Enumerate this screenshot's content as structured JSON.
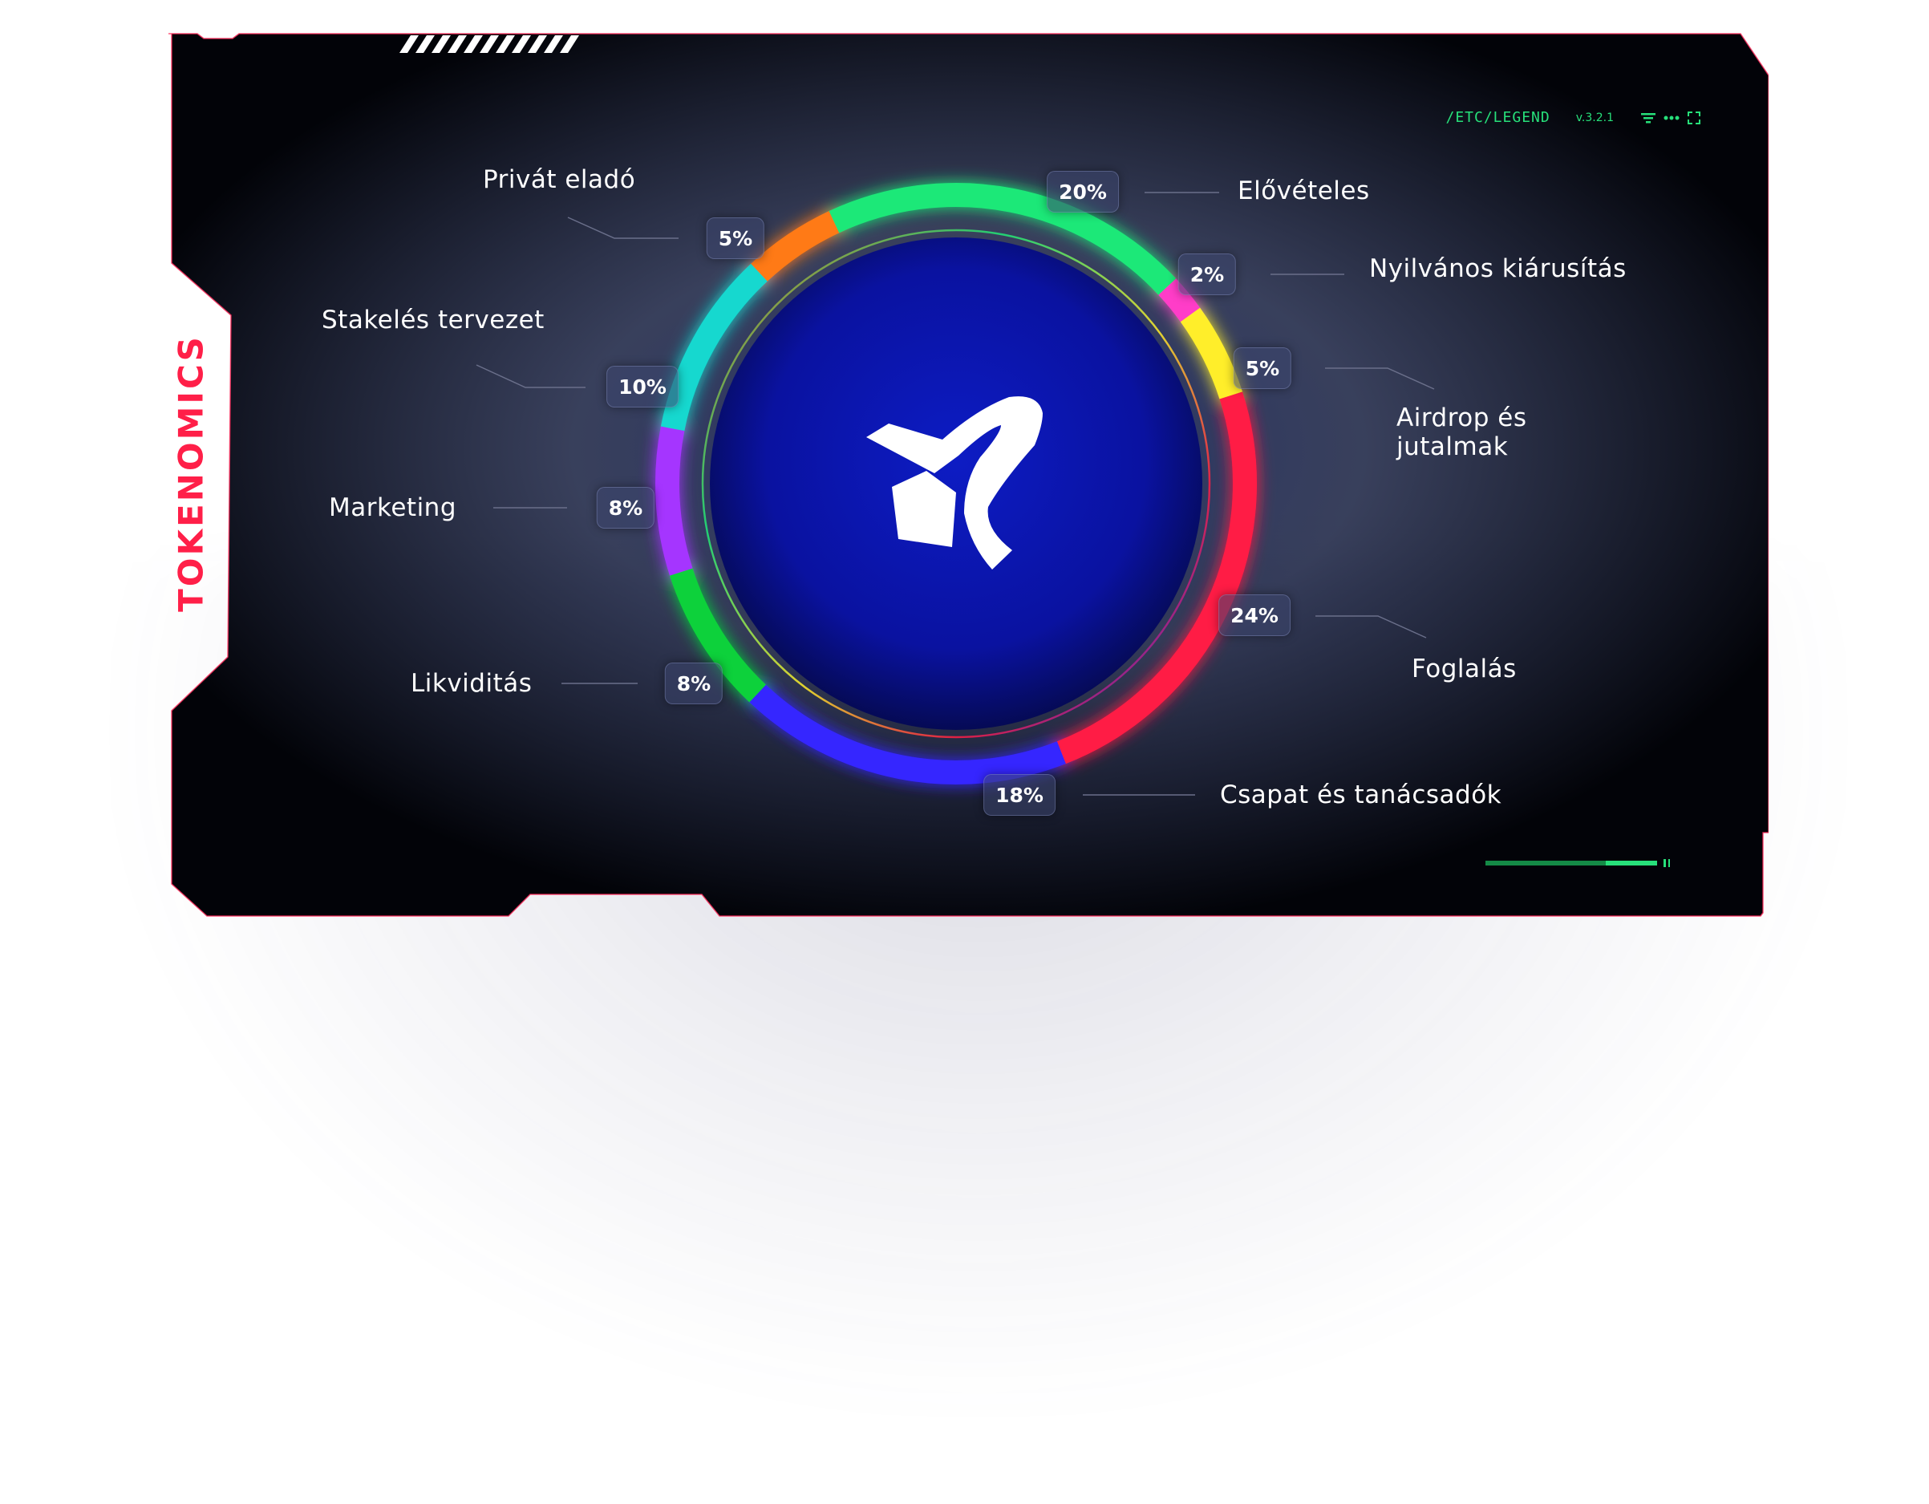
{
  "panel": {
    "title": "TOKENOMICS",
    "path": "/ETC/LEGEND",
    "version": "v.3.2.1",
    "icons": [
      "filter-icon",
      "more-icon",
      "expand-icon"
    ]
  },
  "colors": {
    "accent_green": "#27e07a",
    "title_red": "#ff1f48",
    "panel_bg": "#020308",
    "inner_circle": "#0a14a8"
  },
  "chart_data": {
    "type": "pie",
    "variant": "donut",
    "unit": "%",
    "slices": [
      {
        "name": "Elővételes",
        "value": 20,
        "label": "20%",
        "color": "#1ee878"
      },
      {
        "name": "Nyilvános kiárusítás",
        "value": 2,
        "label": "2%",
        "color": "#ff3cc8"
      },
      {
        "name": "Airdrop és jutalmak",
        "value": 5,
        "label": "5%",
        "color": "#ffee2a"
      },
      {
        "name": "Foglalás",
        "value": 24,
        "label": "24%",
        "color": "#ff1e44"
      },
      {
        "name": "Csapat és tanácsadók",
        "value": 18,
        "label": "18%",
        "color": "#3425ff"
      },
      {
        "name": "Likviditás",
        "value": 8,
        "label": "8%",
        "color": "#0ad13a"
      },
      {
        "name": "Marketing",
        "value": 8,
        "label": "8%",
        "color": "#a534ff"
      },
      {
        "name": "Stakelés tervezet",
        "value": 10,
        "label": "10%",
        "color": "#12d8cf"
      },
      {
        "name": "Privát eladó",
        "value": 5,
        "label": "5%",
        "color": "#ff7a14"
      }
    ]
  }
}
